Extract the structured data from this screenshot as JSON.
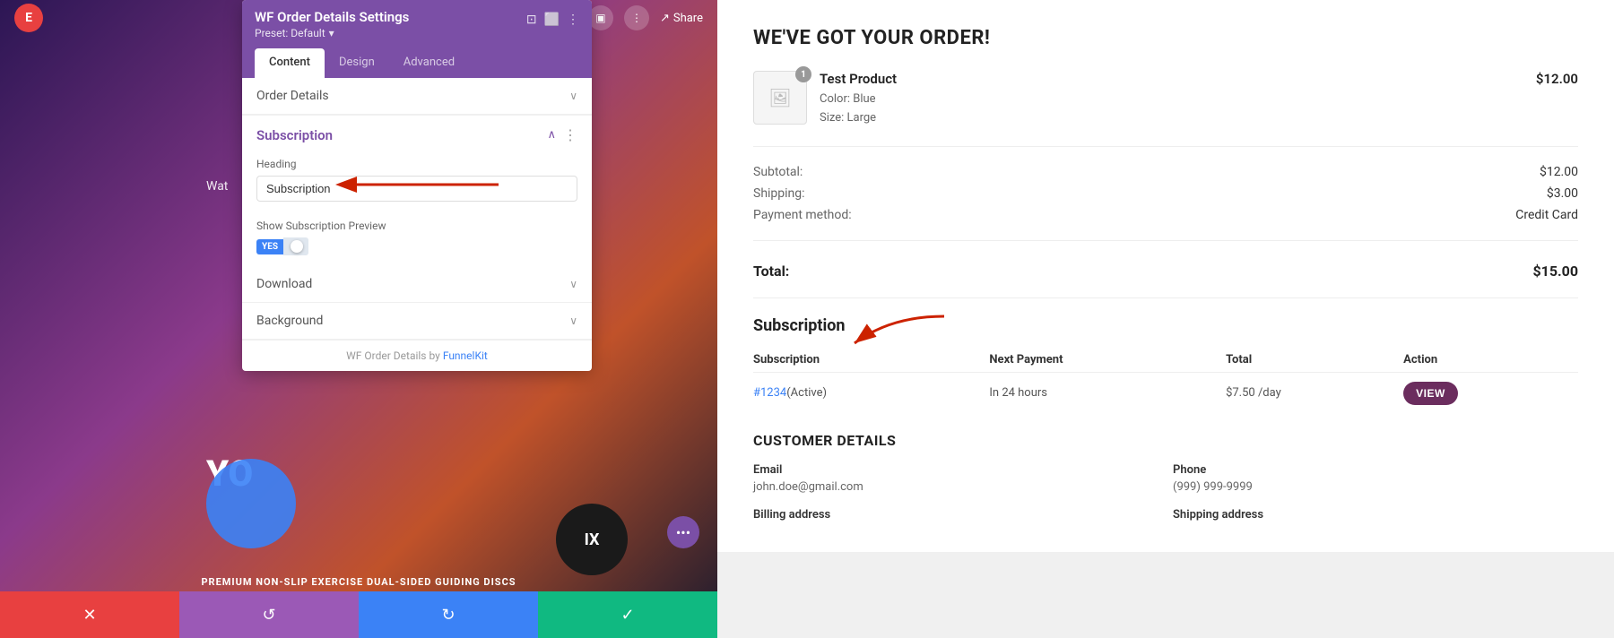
{
  "editor": {
    "elementor_icon": "E",
    "share_label": "Share",
    "settings_panel": {
      "title": "WF Order Details Settings",
      "preset_label": "Preset: Default",
      "preset_arrow": "▾",
      "tabs": [
        {
          "id": "content",
          "label": "Content"
        },
        {
          "id": "design",
          "label": "Design"
        },
        {
          "id": "advanced",
          "label": "Advanced"
        }
      ],
      "active_tab": "content",
      "sections": {
        "order_details": {
          "label": "Order Details",
          "expanded": false
        },
        "subscription": {
          "label": "Subscription",
          "expanded": true,
          "heading_field": {
            "label": "Heading",
            "value": "Subscription",
            "placeholder": "Subscription"
          },
          "show_preview_field": {
            "label": "Show Subscription Preview",
            "value": "YES",
            "enabled": true
          }
        },
        "download": {
          "label": "Download",
          "expanded": false
        },
        "background": {
          "label": "Background",
          "expanded": false
        }
      },
      "footer_text": "WF Order Details by ",
      "footer_link_label": "FunnelKit",
      "footer_link_url": "#"
    },
    "bottom_bar": {
      "cancel_icon": "✕",
      "undo_icon": "↺",
      "redo_icon": "↻",
      "confirm_icon": "✓"
    },
    "overlay_texts": {
      "you": "YO",
      "watch": "Wat",
      "premium": "PREMIUM NON-SLIP EXERCISE    DUAL-SIDED GUIDING DISCS"
    }
  },
  "order_page": {
    "title": "WE'VE GOT YOUR ORDER!",
    "product": {
      "name": "Test Product",
      "color_label": "Color:",
      "color_value": "Blue",
      "size_label": "Size:",
      "size_value": "Large",
      "price": "$12.00",
      "quantity": "1"
    },
    "summary": {
      "subtotal_label": "Subtotal:",
      "subtotal_value": "$12.00",
      "shipping_label": "Shipping:",
      "shipping_value": "$3.00",
      "payment_label": "Payment method:",
      "payment_value": "Credit Card",
      "total_label": "Total:",
      "total_value": "$15.00"
    },
    "subscription_section": {
      "title": "Subscription",
      "table_headers": {
        "subscription": "Subscription",
        "next_payment": "Next Payment",
        "total": "Total",
        "action": "Action"
      },
      "row": {
        "id_link": "#1234",
        "status": "(Active)",
        "next_payment": "In 24 hours",
        "total": "$7.50 /day",
        "action_label": "VIEW"
      }
    },
    "customer_section": {
      "title": "CUSTOMER DETAILS",
      "email_label": "Email",
      "email_value": "john.doe@gmail.com",
      "phone_label": "Phone",
      "phone_value": "(999) 999-9999",
      "billing_label": "Billing address",
      "shipping_label": "Shipping address"
    }
  },
  "colors": {
    "purple": "#7b4fa6",
    "blue": "#3b82f6",
    "red": "#e84040",
    "green": "#10b981",
    "dark_purple_btn": "#6b2d5e",
    "arrow_red": "#cc2200"
  }
}
